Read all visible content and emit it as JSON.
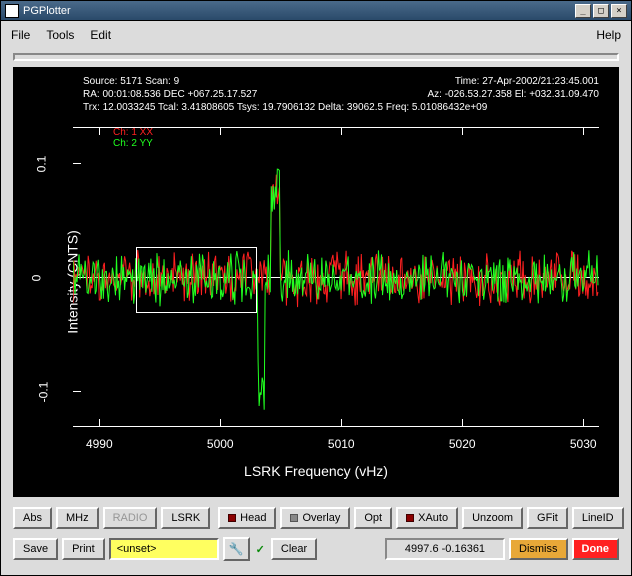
{
  "window": {
    "title": "PGPlotter"
  },
  "menu": {
    "file": "File",
    "tools": "Tools",
    "edit": "Edit",
    "help": "Help"
  },
  "header": {
    "l1a": "Source: 5171 Scan: 9",
    "l1b": "Time: 27-Apr-2002/21:23:45.001",
    "l2a": "RA: 00:01:08.536 DEC  +067.25.17.527",
    "l2b": "Az: -026.53.27.358 El: +032.31.09.470",
    "l3": "Trx: 12.0033245 Tcal: 3.41808605 Tsys: 19.7906132 Delta: 39062.5 Freq: 5.01086432e+09"
  },
  "legend": {
    "xx": "Ch: 1 XX",
    "yy": "Ch: 2 YY"
  },
  "axes": {
    "ylabel": "Intensity (CNTS)",
    "xlabel": "LSRK Frequency (vHz)",
    "yticks": [
      "-0.1",
      "0",
      "0.1"
    ],
    "xticks": [
      "4990",
      "5000",
      "5010",
      "5020",
      "5030"
    ]
  },
  "toolbar1": {
    "abs": "Abs",
    "mhz": "MHz",
    "radio": "RADIO",
    "lsrk": "LSRK",
    "head": "Head",
    "overlay": "Overlay",
    "opt": "Opt",
    "xauto": "XAuto",
    "unzoom": "Unzoom",
    "gfit": "GFit",
    "lineid": "LineID"
  },
  "toolbar2": {
    "save": "Save",
    "print": "Print",
    "input": "<unset>",
    "clear": "Clear",
    "status": "4997.6    -0.16361",
    "dismiss": "Dismiss",
    "done": "Done"
  },
  "chart_data": {
    "type": "line",
    "title": "",
    "xlabel": "LSRK Frequency (vHz)",
    "ylabel": "Intensity (CNTS)",
    "xlim": [
      4990,
      5032
    ],
    "ylim": [
      -0.15,
      0.15
    ],
    "series": [
      {
        "name": "Ch: 1 XX",
        "color": "#ff2020",
        "description": "noise spectrum centered at 0 with amplitude ~0.05, spike to ~0.12 near 5006"
      },
      {
        "name": "Ch: 2 YY",
        "color": "#20ff20",
        "description": "noise spectrum centered at 0 with amplitude ~0.05, spike to ~0.12 near 5006, dip to ~-0.13 near 5004"
      }
    ],
    "selection_box": {
      "x0": 4993.5,
      "x1": 5003,
      "y0": -0.035,
      "y1": 0.03
    },
    "cursor": {
      "x": 4997.6,
      "y": -0.16361
    }
  }
}
